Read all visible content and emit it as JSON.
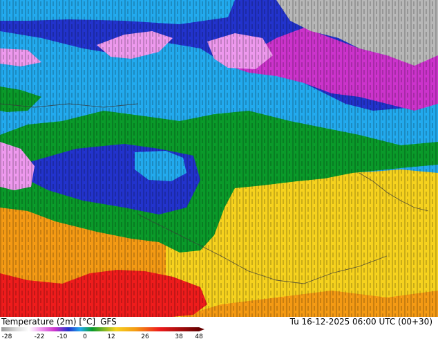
{
  "legend": {
    "variable": "Temperature (2m) [°C]",
    "model": "GFS",
    "valid_time": "Tu 16-12-2025 06:00 UTC (00+30)",
    "ticks": [
      "-28",
      "-22",
      "-10",
      "0",
      "12",
      "26",
      "38",
      "48"
    ]
  },
  "colors": {
    "below_minus10": "#cc33cc",
    "very_cold": "#ee99ee",
    "freezing_blue": "#2233cc",
    "cool_cyan": "#22aaee",
    "mild_green": "#0a9a2a",
    "warm_yellow": "#f6d21e",
    "hot_orange": "#f49a14",
    "very_hot_red": "#ee1c1c",
    "arctic_gray": "#b8b8b8"
  }
}
